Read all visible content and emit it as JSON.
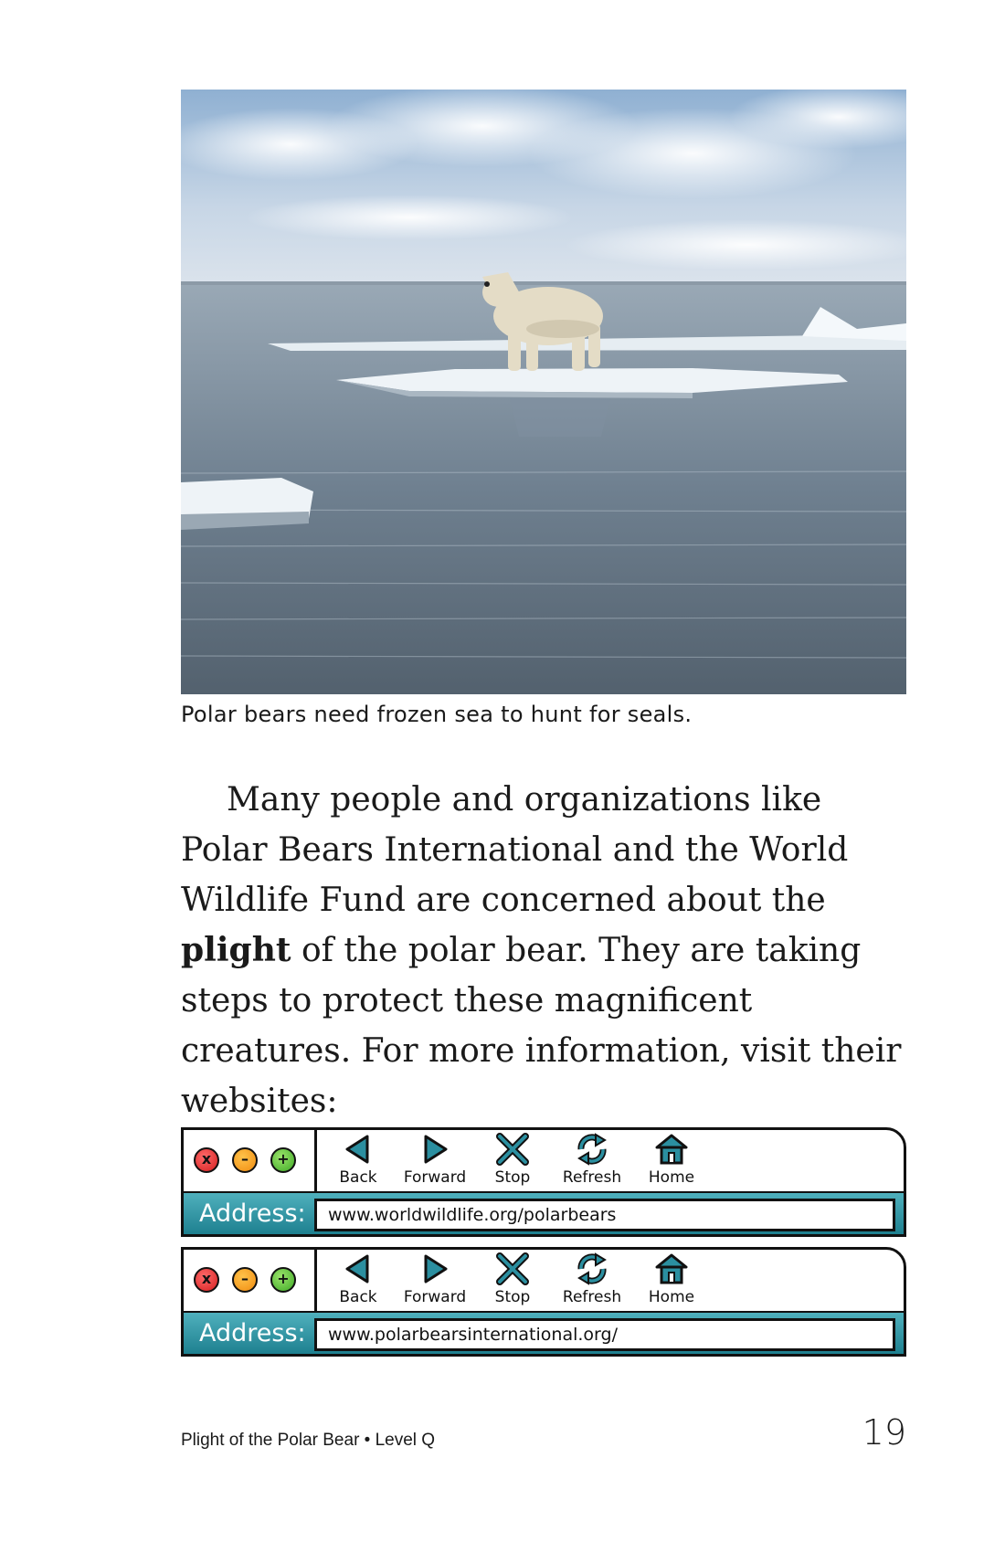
{
  "photo": {
    "icon": "polar-bear-on-ice-floe"
  },
  "caption": "Polar bears need frozen sea to hunt for seals.",
  "paragraph": {
    "before": "Many people and organizations like Polar Bears International and the World Wildlife Fund are concerned about the ",
    "bold": "plight",
    "after": " of the polar bear. They are taking steps to protect these magnificent creatures. For more information, visit their websites:"
  },
  "browsers": [
    {
      "window_buttons": {
        "close": "x",
        "minimize": "–",
        "maximize": "+"
      },
      "nav": {
        "back": "Back",
        "forward": "Forward",
        "stop": "Stop",
        "refresh": "Refresh",
        "home": "Home"
      },
      "address_label": "Address:",
      "address": "www.worldwildlife.org/polarbears"
    },
    {
      "window_buttons": {
        "close": "x",
        "minimize": "–",
        "maximize": "+"
      },
      "nav": {
        "back": "Back",
        "forward": "Forward",
        "stop": "Stop",
        "refresh": "Refresh",
        "home": "Home"
      },
      "address_label": "Address:",
      "address": "www.polarbearsinternational.org/"
    }
  ],
  "footer": {
    "title": "Plight of the Polar Bear • Level Q",
    "page_number": "19"
  },
  "colors": {
    "address_band": "#2a93a2",
    "close": "#d41f1f",
    "minimize": "#f08c10",
    "maximize": "#3eaa26",
    "nav_icon": "#2b8fa0"
  }
}
